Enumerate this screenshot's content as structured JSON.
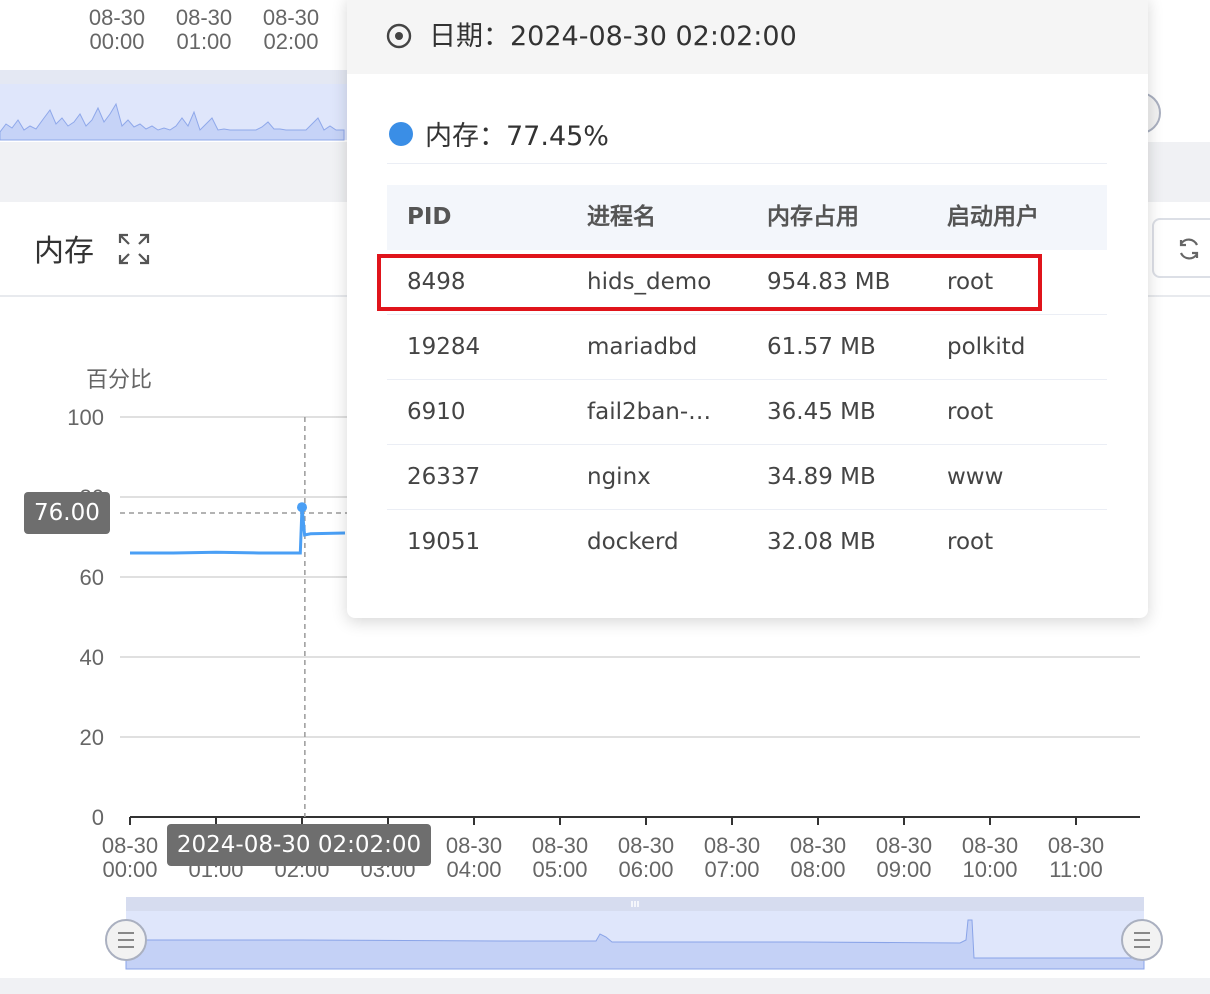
{
  "panel": {
    "title": "内存"
  },
  "top_overview": {
    "x_labels": [
      {
        "day": "08-30",
        "time": "00:00"
      },
      {
        "day": "08-30",
        "time": "01:00"
      },
      {
        "day": "08-30",
        "time": "02:00"
      }
    ]
  },
  "chart_data": {
    "type": "line",
    "ylabel": "百分比",
    "ylim": [
      0,
      100
    ],
    "yticks": [
      0,
      20,
      40,
      60,
      80,
      100
    ],
    "categories": [
      "08-30 00:00",
      "08-30 01:00",
      "08-30 02:00",
      "08-30 03:00",
      "08-30 04:00",
      "08-30 05:00",
      "08-30 06:00",
      "08-30 07:00",
      "08-30 08:00",
      "08-30 09:00",
      "08-30 10:00",
      "08-30 11:00"
    ],
    "xtick_labels": [
      {
        "day": "08-30",
        "time": "00:00"
      },
      {
        "day": "08-30",
        "time": "01:00"
      },
      {
        "day": "08-30",
        "time": "02:00"
      },
      {
        "day": "08-30",
        "time": "03:00"
      },
      {
        "day": "08-30",
        "time": "04:00"
      },
      {
        "day": "08-30",
        "time": "05:00"
      },
      {
        "day": "08-30",
        "time": "06:00"
      },
      {
        "day": "08-30",
        "time": "07:00"
      },
      {
        "day": "08-30",
        "time": "08:00"
      },
      {
        "day": "08-30",
        "time": "09:00"
      },
      {
        "day": "08-30",
        "time": "10:00"
      },
      {
        "day": "08-30",
        "time": "11:00"
      }
    ],
    "series": [
      {
        "color": "#4a9ff5",
        "x_hours": [
          0.0,
          0.5,
          1.0,
          1.5,
          1.98,
          2.0,
          2.03,
          2.1,
          2.5
        ],
        "values": [
          66.0,
          66.0,
          66.2,
          66.0,
          66.0,
          77.45,
          70.5,
          70.8,
          71.0
        ]
      }
    ],
    "axis_pointer": {
      "x_label": "2024-08-30 02:02:00",
      "y_label": "76.00",
      "y_value": 76.0,
      "x_hour": 2.0333
    },
    "grid": true
  },
  "tooltip": {
    "date_label": "日期：2024-08-30 02:02:00",
    "series_label": "内存：77.45%",
    "columns": [
      "PID",
      "进程名",
      "内存占用",
      "启动用户"
    ],
    "rows": [
      {
        "pid": "8498",
        "name": "hids_demo",
        "mem": "954.83 MB",
        "user": "root"
      },
      {
        "pid": "19284",
        "name": "mariadbd",
        "mem": "61.57 MB",
        "user": "polkitd"
      },
      {
        "pid": "6910",
        "name": "fail2ban-…",
        "mem": "36.45 MB",
        "user": "root"
      },
      {
        "pid": "26337",
        "name": "nginx",
        "mem": "34.89 MB",
        "user": "www"
      },
      {
        "pid": "19051",
        "name": "dockerd",
        "mem": "32.08 MB",
        "user": "root"
      }
    ]
  },
  "colors": {
    "series": "#4a9ff5",
    "highlight": "#e0141b",
    "zoom_fill": "#dfe6fb"
  }
}
